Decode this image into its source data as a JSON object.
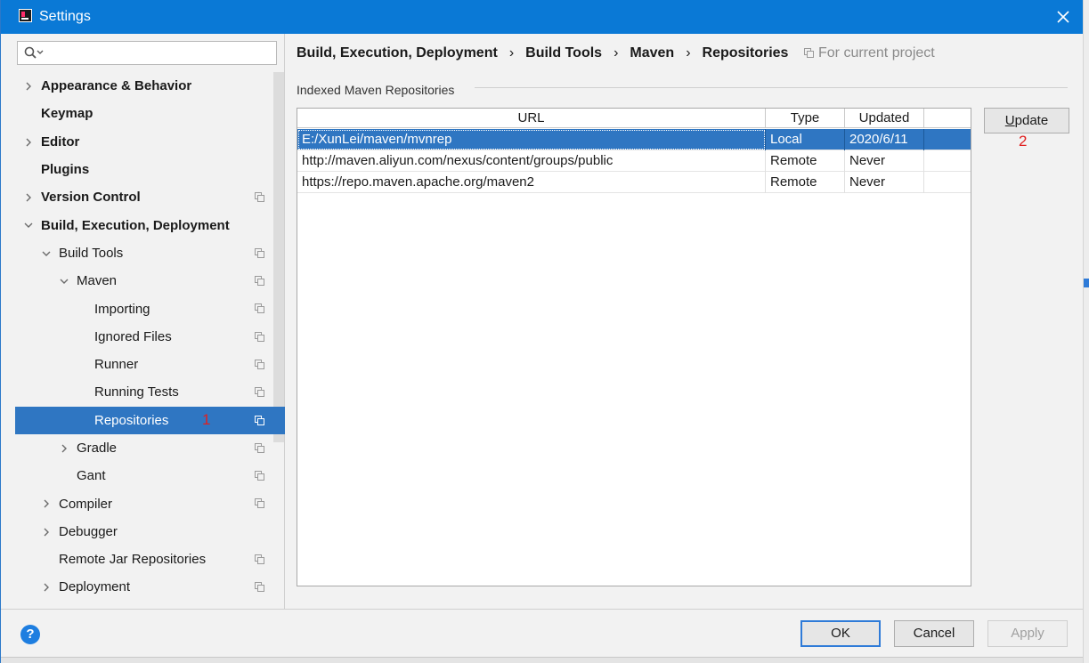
{
  "window": {
    "title": "Settings"
  },
  "sidebar": {
    "search_placeholder": "",
    "items": [
      {
        "label": "Appearance & Behavior",
        "bold": true,
        "arrow": "right",
        "indent": 0,
        "copy": false
      },
      {
        "label": "Keymap",
        "bold": true,
        "arrow": "",
        "indent": 0,
        "copy": false
      },
      {
        "label": "Editor",
        "bold": true,
        "arrow": "right",
        "indent": 0,
        "copy": false
      },
      {
        "label": "Plugins",
        "bold": true,
        "arrow": "",
        "indent": 0,
        "copy": false
      },
      {
        "label": "Version Control",
        "bold": true,
        "arrow": "right",
        "indent": 0,
        "copy": true
      },
      {
        "label": "Build, Execution, Deployment",
        "bold": true,
        "arrow": "down",
        "indent": 0,
        "copy": false
      },
      {
        "label": "Build Tools",
        "bold": false,
        "arrow": "down",
        "indent": 1,
        "copy": true
      },
      {
        "label": "Maven",
        "bold": false,
        "arrow": "down",
        "indent": 2,
        "copy": true
      },
      {
        "label": "Importing",
        "bold": false,
        "arrow": "",
        "indent": 3,
        "copy": true
      },
      {
        "label": "Ignored Files",
        "bold": false,
        "arrow": "",
        "indent": 3,
        "copy": true
      },
      {
        "label": "Runner",
        "bold": false,
        "arrow": "",
        "indent": 3,
        "copy": true
      },
      {
        "label": "Running Tests",
        "bold": false,
        "arrow": "",
        "indent": 3,
        "copy": true
      },
      {
        "label": "Repositories",
        "bold": false,
        "arrow": "",
        "indent": 3,
        "copy": true,
        "selected": true
      },
      {
        "label": "Gradle",
        "bold": false,
        "arrow": "right",
        "indent": 2,
        "copy": true
      },
      {
        "label": "Gant",
        "bold": false,
        "arrow": "",
        "indent": 2,
        "copy": true
      },
      {
        "label": "Compiler",
        "bold": false,
        "arrow": "right",
        "indent": 1,
        "copy": true
      },
      {
        "label": "Debugger",
        "bold": false,
        "arrow": "right",
        "indent": 1,
        "copy": false
      },
      {
        "label": "Remote Jar Repositories",
        "bold": false,
        "arrow": "",
        "indent": 1,
        "copy": true
      },
      {
        "label": "Deployment",
        "bold": false,
        "arrow": "right",
        "indent": 1,
        "copy": true
      }
    ],
    "annotation": "1"
  },
  "breadcrumb": {
    "parts": [
      "Build, Execution, Deployment",
      "Build Tools",
      "Maven",
      "Repositories"
    ],
    "separator": "›",
    "scope": "For current project"
  },
  "section": {
    "title": "Indexed Maven Repositories"
  },
  "table": {
    "columns": [
      "URL",
      "Type",
      "Updated"
    ],
    "rows": [
      {
        "url": "E:/XunLei/maven/mvnrep",
        "type": "Local",
        "updated": "2020/6/11",
        "selected": true
      },
      {
        "url": "http://maven.aliyun.com/nexus/content/groups/public",
        "type": "Remote",
        "updated": "Never"
      },
      {
        "url": "https://repo.maven.apache.org/maven2",
        "type": "Remote",
        "updated": "Never"
      }
    ]
  },
  "update_button": {
    "label_mnemonic": "U",
    "label_rest": "pdate",
    "annotation": "2"
  },
  "footer": {
    "help": "?",
    "ok": "OK",
    "cancel": "Cancel",
    "apply": "Apply"
  },
  "colors": {
    "titlebar": "#0a79d6",
    "selection": "#2f76c2",
    "annotation": "#e02020",
    "help": "#1e7ee0"
  },
  "icons": {
    "close": "close-icon",
    "search": "search-icon",
    "copy": "project-scope-icon"
  }
}
